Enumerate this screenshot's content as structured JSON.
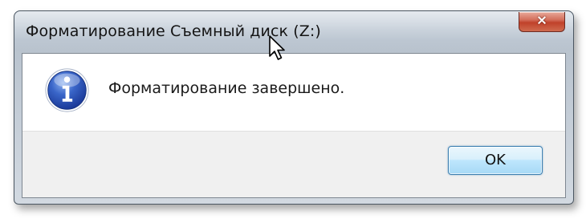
{
  "window": {
    "title": "Форматирование Съемный диск (Z:)",
    "close_icon": "×"
  },
  "dialog": {
    "icon": "info-icon",
    "message": "Форматирование завершено.",
    "ok_label": "OK"
  },
  "colors": {
    "info_icon_blue": "#2a52be",
    "close_button_red": "#c0412a",
    "ok_button_border": "#3c7fb1"
  }
}
